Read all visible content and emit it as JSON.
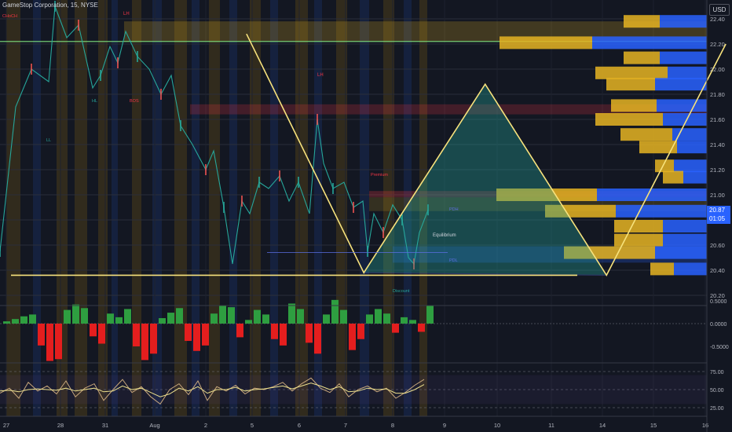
{
  "header": {
    "symbol": "GameStop Corporation, 15, NYSE",
    "currency": "USD",
    "last_price": "20.87",
    "countdown": "01:05"
  },
  "colors": {
    "background": "#131722",
    "triangle": "#5b6ee1",
    "triangle_fill": "#26a69a",
    "yellow_lines": "#f7e27c",
    "green_hline": "#7ee07e",
    "vp_up": "#2962ff",
    "vp_down": "#e6b422",
    "osc_up": "#2e9e40",
    "osc_down": "#e41e1e",
    "rsi": "#c9a87c",
    "rsi_ma": "#ede08c"
  },
  "labels": {
    "lh_left": "LH",
    "lh_top": "LH",
    "ll": "LL",
    "hl": "HL",
    "bos": "BOS",
    "choch": "CHoCH",
    "premium": "Premium",
    "equilibrium": "Equilibrium",
    "discount": "Discount",
    "pdh": "PDH",
    "pdl": "PDL"
  },
  "chart_data": [
    {
      "type": "line",
      "name": "price",
      "x_ticks": [
        "27",
        "28",
        "31",
        "Aug",
        "2",
        "5",
        "6",
        "7",
        "8",
        "9",
        "10",
        "11",
        "14",
        "15",
        "16"
      ],
      "y_ticks": [
        "22.40",
        "22.20",
        "22.00",
        "21.80",
        "21.60",
        "21.40",
        "21.20",
        "21.00",
        "20.80",
        "20.60",
        "20.40",
        "20.20"
      ],
      "ylim": [
        20.1,
        22.45
      ],
      "pattern": [
        {
          "time": 6.25,
          "price": 22.28
        },
        {
          "time": 9.15,
          "price": 20.38
        },
        {
          "time": 12.15,
          "price": 21.88
        },
        {
          "time": 15.15,
          "price": 20.36
        },
        {
          "time": 18.1,
          "price": 22.2
        }
      ],
      "hlines": [
        22.22,
        20.36
      ],
      "volume_profile": [
        {
          "price": 22.38,
          "up": 60,
          "down": 46
        },
        {
          "price": 22.21,
          "up": 146,
          "down": 118
        },
        {
          "price": 22.09,
          "up": 60,
          "down": 46
        },
        {
          "price": 21.97,
          "up": 50,
          "down": 92
        },
        {
          "price": 21.88,
          "up": 66,
          "down": 62
        },
        {
          "price": 21.71,
          "up": 64,
          "down": 58
        },
        {
          "price": 21.6,
          "up": 56,
          "down": 86
        },
        {
          "price": 21.48,
          "up": 44,
          "down": 66
        },
        {
          "price": 21.38,
          "up": 38,
          "down": 48
        },
        {
          "price": 21.23,
          "up": 42,
          "down": 24
        },
        {
          "price": 21.14,
          "up": 30,
          "down": 26
        },
        {
          "price": 21.0,
          "up": 140,
          "down": 128
        },
        {
          "price": 20.87,
          "up": 116,
          "down": 90
        },
        {
          "price": 20.75,
          "up": 56,
          "down": 62
        },
        {
          "price": 20.64,
          "up": 56,
          "down": 62
        },
        {
          "price": 20.54,
          "up": 66,
          "down": 116
        },
        {
          "price": 20.41,
          "up": 42,
          "down": 30
        }
      ]
    },
    {
      "type": "bar",
      "name": "oscillator",
      "y_ticks": [
        "0.5000",
        "0.0000",
        "-0.5000"
      ],
      "ylim": [
        -0.85,
        0.55
      ],
      "values": [
        0.05,
        0.1,
        0.16,
        0.2,
        -0.48,
        -0.82,
        -0.78,
        0.3,
        0.42,
        0.34,
        -0.28,
        -0.44,
        0.22,
        0.14,
        0.32,
        -0.5,
        -0.8,
        -0.66,
        0.12,
        0.24,
        0.34,
        -0.38,
        -0.6,
        -0.48,
        0.22,
        0.4,
        0.36,
        -0.3,
        0.08,
        0.3,
        0.2,
        -0.34,
        -0.48,
        0.44,
        0.32,
        -0.42,
        -0.66,
        0.2,
        0.52,
        0.3,
        -0.58,
        -0.34,
        0.2,
        0.32,
        0.22,
        -0.2,
        0.14,
        0.08,
        -0.18,
        0.4
      ]
    },
    {
      "type": "line",
      "name": "rsi",
      "y_ticks": [
        "75.00",
        "50.00",
        "25.00"
      ],
      "ylim": [
        20,
        82
      ],
      "x": [
        0,
        12,
        24,
        36,
        48,
        60,
        72,
        84,
        96,
        108,
        120,
        132,
        144,
        156,
        168,
        180,
        192,
        204,
        216,
        228,
        240,
        252,
        264,
        276,
        288,
        300,
        312,
        324,
        336,
        348,
        360,
        372,
        384,
        396,
        408,
        420,
        432,
        444,
        456,
        468,
        480,
        492,
        504,
        516,
        528,
        540
      ],
      "rsi": [
        45,
        52,
        38,
        60,
        48,
        55,
        44,
        62,
        40,
        52,
        58,
        35,
        50,
        64,
        46,
        54,
        40,
        30,
        50,
        58,
        43,
        62,
        35,
        54,
        48,
        56,
        44,
        52,
        50,
        54,
        60,
        48,
        58,
        66,
        52,
        46,
        58,
        40,
        50,
        55,
        47,
        52,
        38,
        46,
        56,
        64
      ],
      "rsi_ma": [
        48,
        49,
        47,
        50,
        51,
        50,
        49,
        52,
        48,
        50,
        52,
        47,
        48,
        55,
        50,
        52,
        46,
        40,
        44,
        52,
        48,
        54,
        45,
        50,
        50,
        53,
        48,
        50,
        51,
        53,
        55,
        51,
        55,
        59,
        55,
        50,
        54,
        47,
        48,
        52,
        50,
        51,
        45,
        45,
        50,
        57
      ]
    }
  ]
}
